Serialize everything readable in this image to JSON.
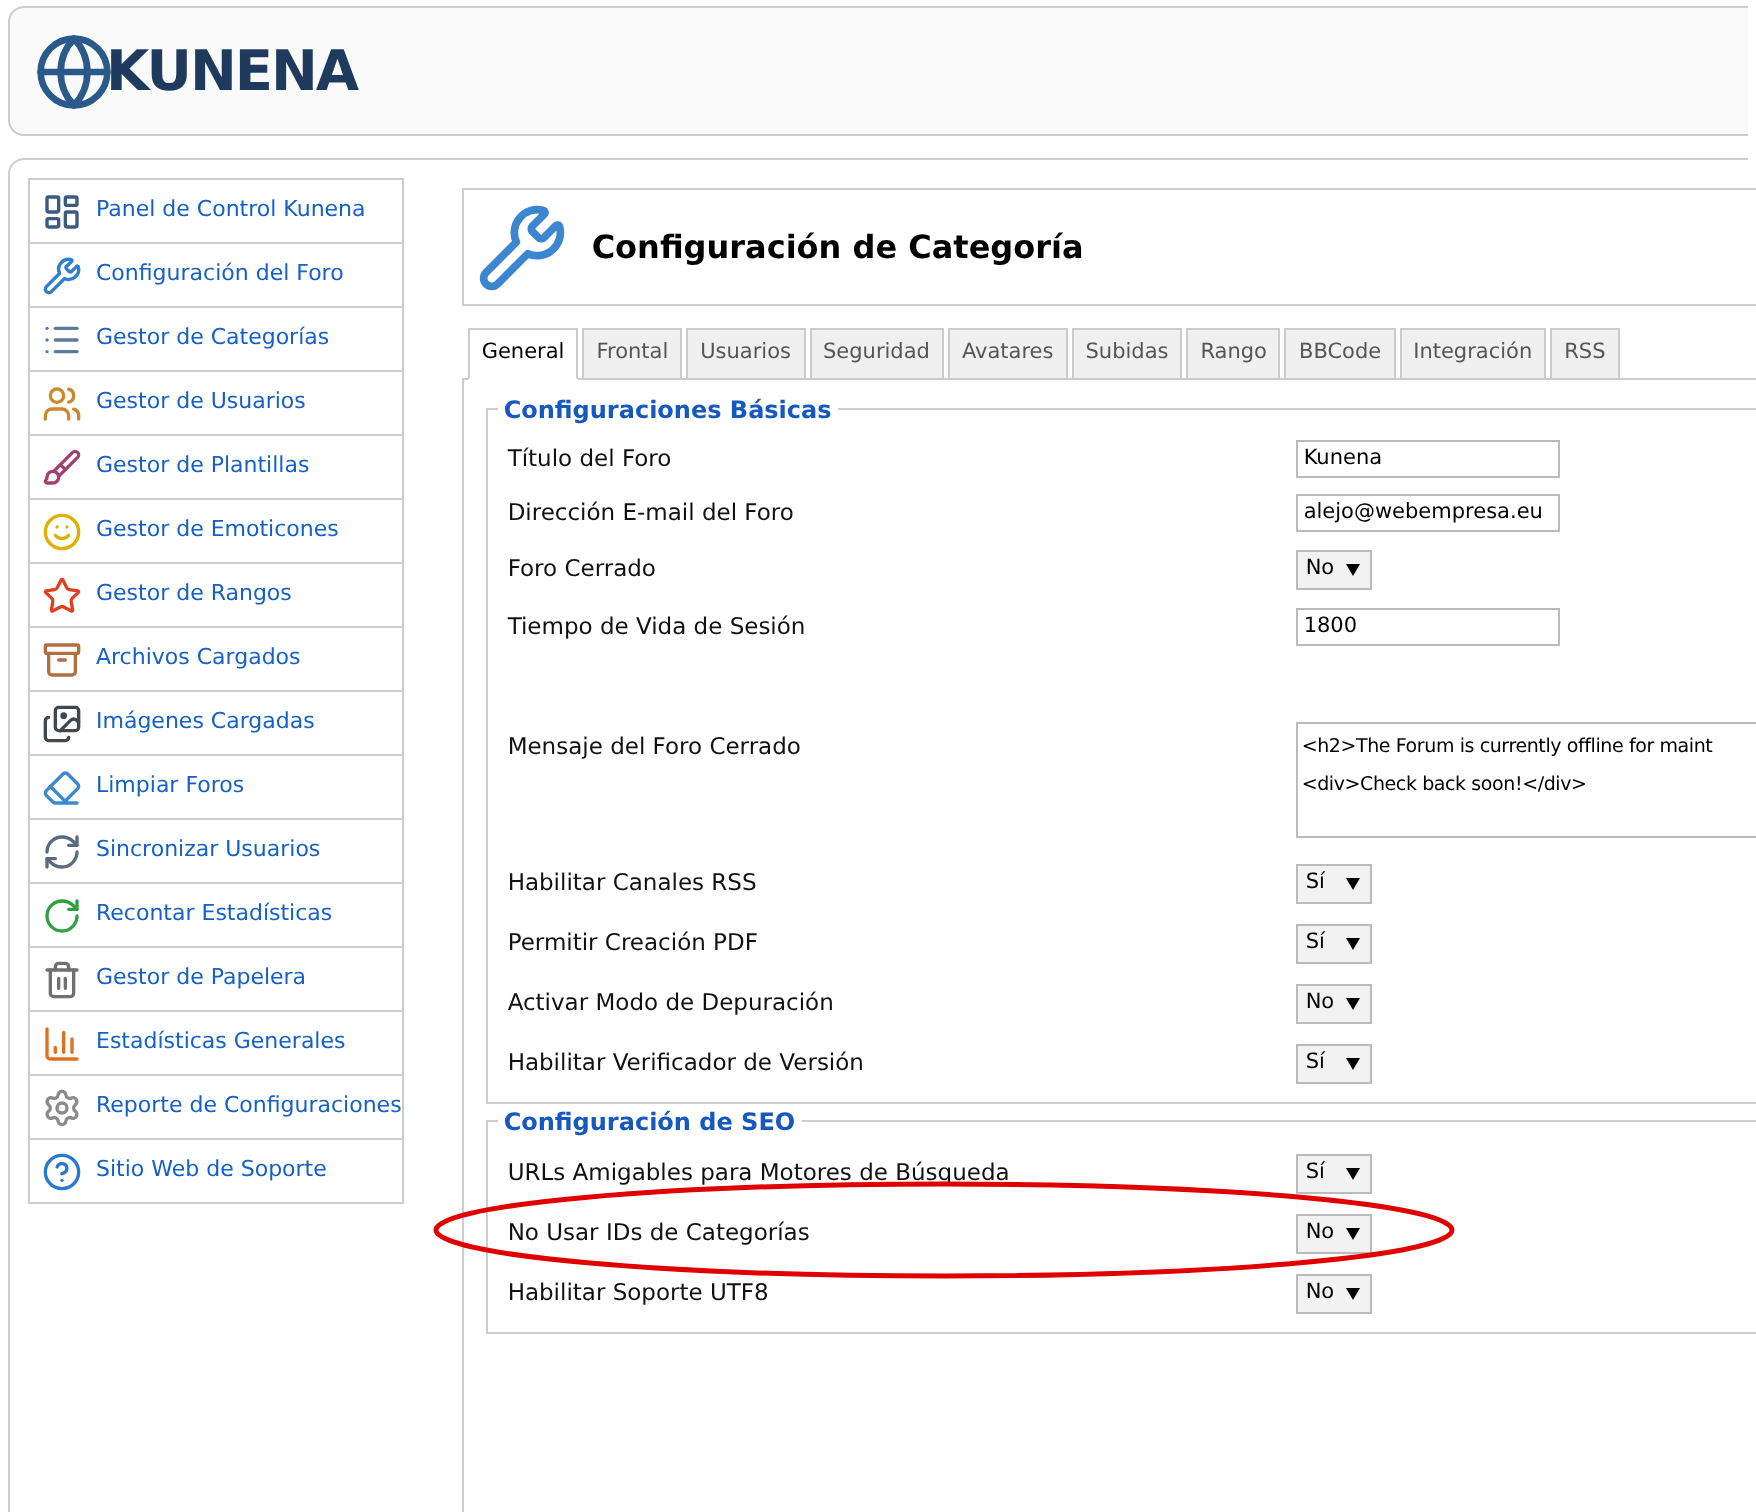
{
  "logo": {
    "text": "KUNENA"
  },
  "sidebar": {
    "items": [
      {
        "kind": "dashboard",
        "label": "Panel de Control Kunena"
      },
      {
        "kind": "tools",
        "label": "Configuración del Foro"
      },
      {
        "kind": "list",
        "label": "Gestor de Categorías"
      },
      {
        "kind": "users",
        "label": "Gestor de Usuarios"
      },
      {
        "kind": "brush",
        "label": "Gestor de Plantillas"
      },
      {
        "kind": "smile",
        "label": "Gestor de Emoticones"
      },
      {
        "kind": "star",
        "label": "Gestor de Rangos"
      },
      {
        "kind": "archive",
        "label": "Archivos Cargados"
      },
      {
        "kind": "images",
        "label": "Imágenes Cargadas"
      },
      {
        "kind": "clean",
        "label": "Limpiar Foros"
      },
      {
        "kind": "sync",
        "label": "Sincronizar Usuarios"
      },
      {
        "kind": "recount",
        "label": "Recontar Estadísticas"
      },
      {
        "kind": "trash",
        "label": "Gestor de Papelera"
      },
      {
        "kind": "chart",
        "label": "Estadísticas Generales"
      },
      {
        "kind": "gear",
        "label": "Reporte de Configuraciones"
      },
      {
        "kind": "help",
        "label": "Sitio Web de Soporte"
      }
    ]
  },
  "page": {
    "title": "Configuración de Categoría"
  },
  "tabs": [
    {
      "label": "General",
      "selected": true
    },
    {
      "label": "Frontal",
      "selected": false
    },
    {
      "label": "Usuarios",
      "selected": false
    },
    {
      "label": "Seguridad",
      "selected": false
    },
    {
      "label": "Avatares",
      "selected": false
    },
    {
      "label": "Subidas",
      "selected": false
    },
    {
      "label": "Rango",
      "selected": false
    },
    {
      "label": "BBCode",
      "selected": false
    },
    {
      "label": "Integración",
      "selected": false
    },
    {
      "label": "RSS",
      "selected": false
    }
  ],
  "sections": [
    {
      "title": "Configuraciones Básicas",
      "rows": [
        {
          "kind": "text",
          "label": "Título del Foro",
          "value": "Kunena",
          "highlighted": false
        },
        {
          "kind": "text",
          "label": "Dirección E-mail del Foro",
          "value": "alejo@webempresa.eu",
          "highlighted": false
        },
        {
          "kind": "select",
          "label": "Foro Cerrado",
          "value": "No",
          "highlighted": false
        },
        {
          "kind": "text",
          "label": "Tiempo de Vida de Sesión",
          "value": "1800",
          "highlighted": false
        },
        {
          "kind": "textarea",
          "label": "Mensaje del Foro Cerrado",
          "lines": [
            "<h2>The Forum is currently offline for maint",
            "<div>Check back soon!</div>"
          ],
          "highlighted": false
        },
        {
          "kind": "select",
          "label": "Habilitar Canales RSS",
          "value": "Sí",
          "highlighted": false
        },
        {
          "kind": "select",
          "label": "Permitir Creación PDF",
          "value": "Sí",
          "highlighted": false
        },
        {
          "kind": "select",
          "label": "Activar Modo de Depuración",
          "value": "No",
          "highlighted": false
        },
        {
          "kind": "select",
          "label": "Habilitar Verificador de Versión",
          "value": "Sí",
          "highlighted": false
        }
      ]
    },
    {
      "title": "Configuración de SEO",
      "rows": [
        {
          "kind": "select",
          "label": "URLs Amigables para Motores de Búsqueda",
          "value": "Sí",
          "highlighted": false
        },
        {
          "kind": "select",
          "label": "No Usar IDs de Categorías",
          "value": "No",
          "highlighted": true
        },
        {
          "kind": "select",
          "label": "Habilitar Soporte UTF8",
          "value": "No",
          "highlighted": false
        }
      ]
    }
  ]
}
